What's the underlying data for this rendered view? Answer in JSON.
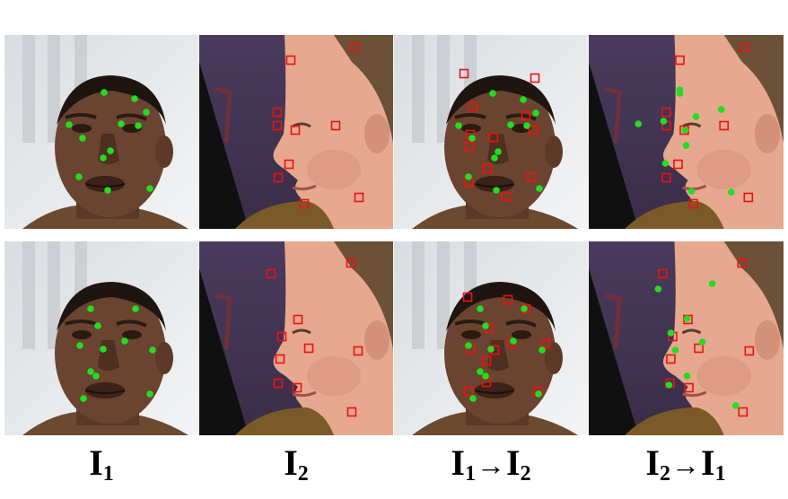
{
  "captions": [
    {
      "base": "I",
      "sub": "1"
    },
    {
      "base": "I",
      "sub": "2"
    },
    {
      "base1": "I",
      "sub1": "1",
      "arrow": "→",
      "base2": "I",
      "sub2": "2"
    },
    {
      "base1": "I",
      "sub1": "2",
      "arrow": "→",
      "base2": "I",
      "sub2": "1"
    }
  ],
  "marker_colors": {
    "green_dot": "#22dd22",
    "red_square": "#ee1111"
  },
  "panels": [
    {
      "row": 0,
      "col": 0,
      "subject": "face-frontal",
      "green": [
        [
          116,
          103
        ],
        [
          150,
          110
        ],
        [
          163,
          125
        ],
        [
          77,
          139
        ],
        [
          92,
          154
        ],
        [
          135,
          138
        ],
        [
          154,
          140
        ],
        [
          123,
          168
        ],
        [
          115,
          176
        ],
        [
          88,
          197
        ],
        [
          120,
          212
        ],
        [
          167,
          210
        ]
      ],
      "red": []
    },
    {
      "row": 0,
      "col": 1,
      "subject": "face-profile",
      "green": [],
      "red": [
        [
          396,
          53
        ],
        [
          324,
          67
        ],
        [
          309,
          125
        ],
        [
          309,
          140
        ],
        [
          329,
          145
        ],
        [
          374,
          140
        ],
        [
          322,
          183
        ],
        [
          310,
          198
        ],
        [
          400,
          220
        ],
        [
          339,
          227
        ]
      ]
    },
    {
      "row": 0,
      "col": 2,
      "subject": "face-frontal",
      "green": [
        [
          549,
          104
        ],
        [
          583,
          111
        ],
        [
          597,
          126
        ],
        [
          511,
          140
        ],
        [
          526,
          154
        ],
        [
          569,
          139
        ],
        [
          587,
          140
        ],
        [
          555,
          169
        ],
        [
          551,
          176
        ],
        [
          522,
          197
        ],
        [
          553,
          212
        ],
        [
          601,
          210
        ]
      ],
      "red": [
        [
          517,
          82
        ],
        [
          596,
          87
        ],
        [
          527,
          119
        ],
        [
          586,
          129
        ],
        [
          524,
          150
        ],
        [
          594,
          145
        ],
        [
          550,
          153
        ],
        [
          523,
          163
        ],
        [
          543,
          188
        ],
        [
          522,
          203
        ],
        [
          592,
          197
        ],
        [
          564,
          219
        ]
      ]
    },
    {
      "row": 0,
      "col": 3,
      "subject": "face-profile",
      "green": [
        [
          757,
          100
        ],
        [
          803,
          122
        ],
        [
          711,
          138
        ],
        [
          739,
          135
        ],
        [
          775,
          130
        ],
        [
          763,
          145
        ],
        [
          764,
          162
        ],
        [
          741,
          182
        ],
        [
          770,
          213
        ],
        [
          814,
          214
        ],
        [
          757,
          104
        ]
      ],
      "red": [
        [
          829,
          53
        ],
        [
          757,
          67
        ],
        [
          742,
          125
        ],
        [
          742,
          140
        ],
        [
          762,
          145
        ],
        [
          806,
          140
        ],
        [
          755,
          183
        ],
        [
          742,
          198
        ],
        [
          833,
          220
        ],
        [
          772,
          227
        ]
      ]
    },
    {
      "row": 1,
      "col": 0,
      "subject": "face-frontal",
      "green": [
        [
          101,
          344
        ],
        [
          151,
          344
        ],
        [
          109,
          363
        ],
        [
          89,
          385
        ],
        [
          115,
          389
        ],
        [
          139,
          380
        ],
        [
          170,
          390
        ],
        [
          101,
          414
        ],
        [
          107,
          419
        ],
        [
          93,
          444
        ],
        [
          167,
          439
        ]
      ],
      "red": []
    },
    {
      "row": 1,
      "col": 1,
      "subject": "face-profile",
      "green": [],
      "red": [
        [
          391,
          293
        ],
        [
          302,
          305
        ],
        [
          332,
          356
        ],
        [
          314,
          375
        ],
        [
          344,
          388
        ],
        [
          399,
          391
        ],
        [
          312,
          400
        ],
        [
          310,
          427
        ],
        [
          331,
          432
        ],
        [
          392,
          459
        ]
      ]
    },
    {
      "row": 1,
      "col": 2,
      "subject": "face-frontal",
      "green": [
        [
          535,
          344
        ],
        [
          584,
          344
        ],
        [
          541,
          363
        ],
        [
          522,
          385
        ],
        [
          547,
          389
        ],
        [
          572,
          380
        ],
        [
          604,
          390
        ],
        [
          535,
          414
        ],
        [
          541,
          419
        ],
        [
          527,
          444
        ],
        [
          600,
          439
        ]
      ],
      "red": [
        [
          521,
          331
        ],
        [
          566,
          334
        ],
        [
          586,
          344
        ],
        [
          545,
          366
        ],
        [
          524,
          389
        ],
        [
          570,
          383
        ],
        [
          608,
          383
        ],
        [
          542,
          402
        ],
        [
          551,
          390
        ],
        [
          542,
          426
        ],
        [
          522,
          436
        ],
        [
          599,
          436
        ]
      ]
    },
    {
      "row": 1,
      "col": 3,
      "subject": "face-profile",
      "green": [
        [
          733,
          322
        ],
        [
          793,
          316
        ],
        [
          765,
          355
        ],
        [
          747,
          371
        ],
        [
          782,
          381
        ],
        [
          752,
          390
        ],
        [
          765,
          419
        ],
        [
          745,
          429
        ],
        [
          819,
          452
        ]
      ],
      "red": [
        [
          826,
          293
        ],
        [
          738,
          305
        ],
        [
          766,
          356
        ],
        [
          749,
          375
        ],
        [
          778,
          388
        ],
        [
          834,
          391
        ],
        [
          747,
          400
        ],
        [
          746,
          427
        ],
        [
          767,
          432
        ],
        [
          827,
          459
        ]
      ]
    }
  ]
}
